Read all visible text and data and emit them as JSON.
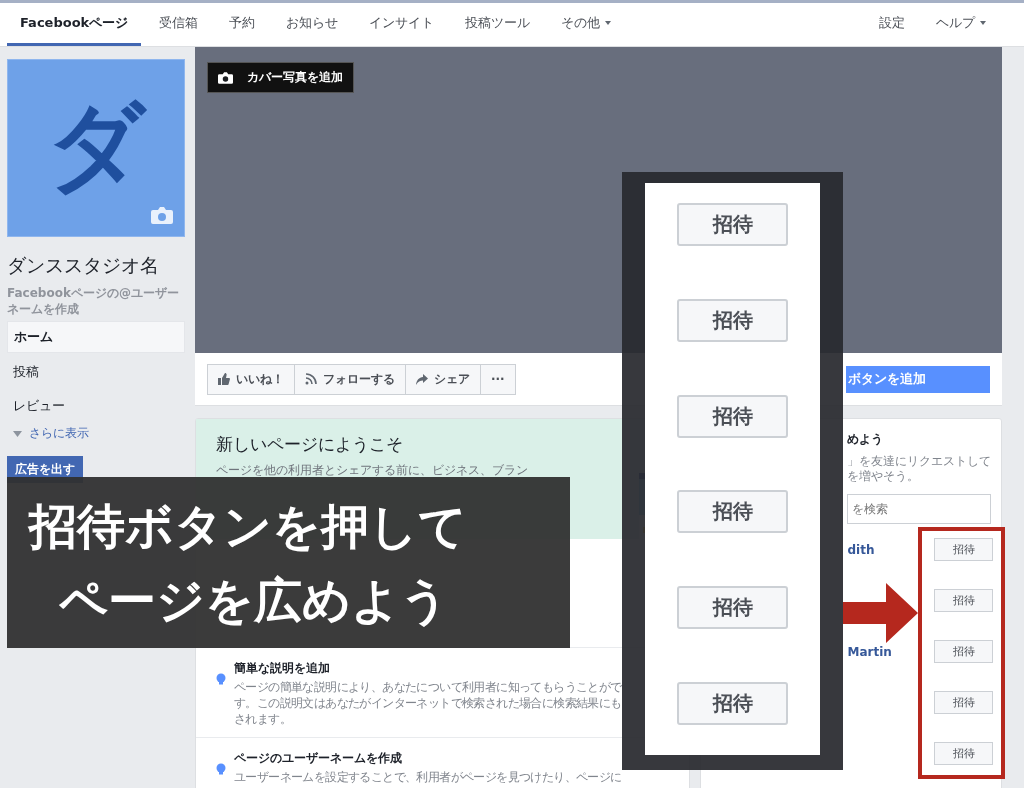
{
  "nav": {
    "tabs": [
      {
        "label": "Facebookページ",
        "selected": true,
        "dropdown": false
      },
      {
        "label": "受信箱",
        "selected": false,
        "dropdown": false
      },
      {
        "label": "予約",
        "selected": false,
        "dropdown": false
      },
      {
        "label": "お知らせ",
        "selected": false,
        "dropdown": false
      },
      {
        "label": "インサイト",
        "selected": false,
        "dropdown": false
      },
      {
        "label": "投稿ツール",
        "selected": false,
        "dropdown": false
      },
      {
        "label": "その他",
        "selected": false,
        "dropdown": true
      }
    ],
    "right_tabs": [
      {
        "label": "設定",
        "dropdown": false
      },
      {
        "label": "ヘルプ",
        "dropdown": true
      }
    ]
  },
  "sidebar": {
    "avatar_letter": "ダ",
    "page_name": "ダンススタジオ名",
    "username_link": "Facebookページの@ユーザーネームを作成",
    "items": [
      {
        "label": "ホーム",
        "selected": true
      },
      {
        "label": "投稿",
        "selected": false
      },
      {
        "label": "レビュー",
        "selected": false
      }
    ],
    "more": "さらに表示",
    "ad_button": "広告を出す"
  },
  "cover": {
    "add_cover_button": "カバー写真を追加"
  },
  "actions": [
    {
      "label": "いいね！",
      "kind": "like"
    },
    {
      "label": "フォローする",
      "kind": "follow"
    },
    {
      "label": "シェア",
      "kind": "share"
    },
    {
      "label": "···",
      "kind": "more"
    }
  ],
  "cta_button": "ボタンを追加",
  "welcome": {
    "title": "新しいページにようこそ",
    "text": "ページを他の利用者とシェアする前に、ビジネス、ブラン",
    "tips": [
      {
        "title": "簡単な説明を追加",
        "lines": [
          "ページの簡単な説明により、あなたについて利用者に知ってもらうことがで",
          "す。この説明文はあなたがインターネットで検索された場合に検索結果にも",
          "されます。"
        ]
      },
      {
        "title": "ページのユーザーネームを作成",
        "lines": [
          "ユーザーネームを設定することで、利用者がページを見つけたり、ページに"
        ]
      }
    ]
  },
  "invite_card": {
    "title": "めよう",
    "lines": [
      "」を友達にリクエストして",
      "を増やそう。"
    ],
    "search": {
      "placeholder": "を検索"
    },
    "friends": [
      {
        "name": "dith",
        "button": "招待"
      },
      {
        "button": "招待"
      },
      {
        "name": "Martin",
        "button": "招待"
      },
      {
        "button": "招待"
      },
      {
        "button": "招待"
      }
    ]
  },
  "zoom_panel": {
    "buttons": [
      "招待",
      "招待",
      "招待",
      "招待",
      "招待",
      "招待"
    ]
  },
  "caption": {
    "lines": [
      "招待ボタンを押して",
      "ページを広めよう"
    ]
  }
}
